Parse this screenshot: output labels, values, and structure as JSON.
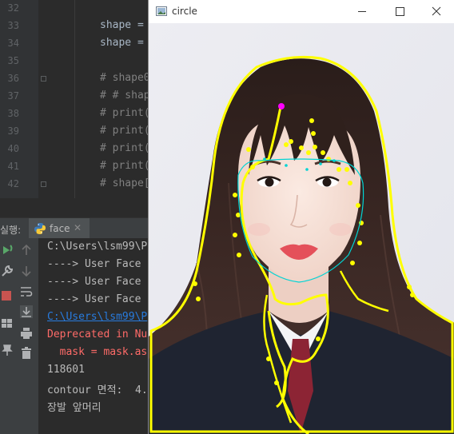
{
  "editor": {
    "line_numbers": [
      "32",
      "33",
      "34",
      "35",
      "36",
      "37",
      "38",
      "39",
      "40",
      "41",
      "42"
    ],
    "lines": [
      {
        "text": "",
        "kind": "normal"
      },
      {
        "text": "shape = ",
        "kind": "normal"
      },
      {
        "text": "shape = ",
        "kind": "normal"
      },
      {
        "text": "",
        "kind": "normal"
      },
      {
        "text": "# shape0",
        "kind": "comment"
      },
      {
        "text": "# # shap",
        "kind": "comment"
      },
      {
        "text": "# print(",
        "kind": "comment"
      },
      {
        "text": "# print(",
        "kind": "comment"
      },
      {
        "text": "# print(",
        "kind": "comment"
      },
      {
        "text": "# print(",
        "kind": "comment"
      },
      {
        "text": "# shape[",
        "kind": "comment"
      }
    ]
  },
  "run_panel": {
    "title": "실행:",
    "tab_label": "face",
    "tab_close": "✕",
    "console_lines": [
      {
        "text": "C:\\Users\\lsm99\\P",
        "kind": "normal"
      },
      {
        "text": "----> User Face",
        "kind": "normal"
      },
      {
        "text": "----> User Face",
        "kind": "normal"
      },
      {
        "text": "----> User Face",
        "kind": "normal"
      },
      {
        "text": "C:\\Users\\lsm99\\P",
        "kind": "link"
      },
      {
        "text": "Deprecated in Nu",
        "kind": "err"
      },
      {
        "text": "  mask = mask.as",
        "kind": "err"
      },
      {
        "text": "118601",
        "kind": "normal"
      },
      {
        "text": "contour 면적:  4.",
        "kind": "normal"
      },
      {
        "text": "장발 앞머리",
        "kind": "normal"
      }
    ],
    "toolbar_icons": [
      "rerun-icon",
      "wrench-icon",
      "stop-icon",
      "layout-icon",
      "pin-icon"
    ],
    "side_icons": [
      "up-arrow-icon",
      "down-arrow-icon",
      "soft-wrap-icon",
      "scroll-to-end-icon",
      "print-icon",
      "trash-icon"
    ]
  },
  "image_window": {
    "title": "circle",
    "buttons": [
      "minimize",
      "maximize",
      "close"
    ],
    "colors": {
      "contour": "#ffff00",
      "face_outline": "#00d4d4",
      "marker": "#ff00ff"
    }
  }
}
